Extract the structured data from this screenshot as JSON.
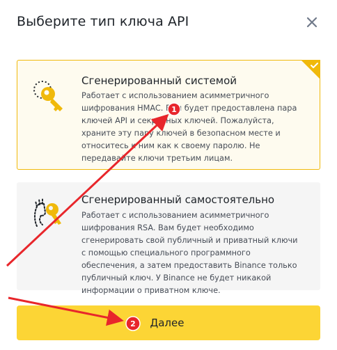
{
  "dialog": {
    "title": "Выберите тип ключа API",
    "close_icon": "close-icon"
  },
  "options": [
    {
      "title": "Сгенерированный системой",
      "description": "Работает с использованием асимметричного шифрования HMAC. Вам будет предоставлена пара ключей API и секретных ключей. Пожалуйста, храните эту пару ключей в безопасном месте и относитесь к ним как к своему паролю. Не передавайте ключи третьим лицам.",
      "icon": "key-icon",
      "selected": true
    },
    {
      "title": "Сгенерированный самостоятельно",
      "description": "Работает с использованием асимметричного шифрования RSA. Вам будет необходимо сгенерировать свой публичный и приватный ключи с помощью специального программного обеспечения, а затем предоставить Binance только публичный ключ. У Binance не будет никакой информации о приватном ключе.",
      "icon": "key-hand-icon",
      "selected": false
    }
  ],
  "next_button": {
    "label": "Далее"
  },
  "annotations": {
    "marker_1": "1",
    "marker_2": "2"
  },
  "colors": {
    "accent": "#fcd535",
    "selected_border": "#f0b90b",
    "annotation_red": "#e8262b"
  }
}
